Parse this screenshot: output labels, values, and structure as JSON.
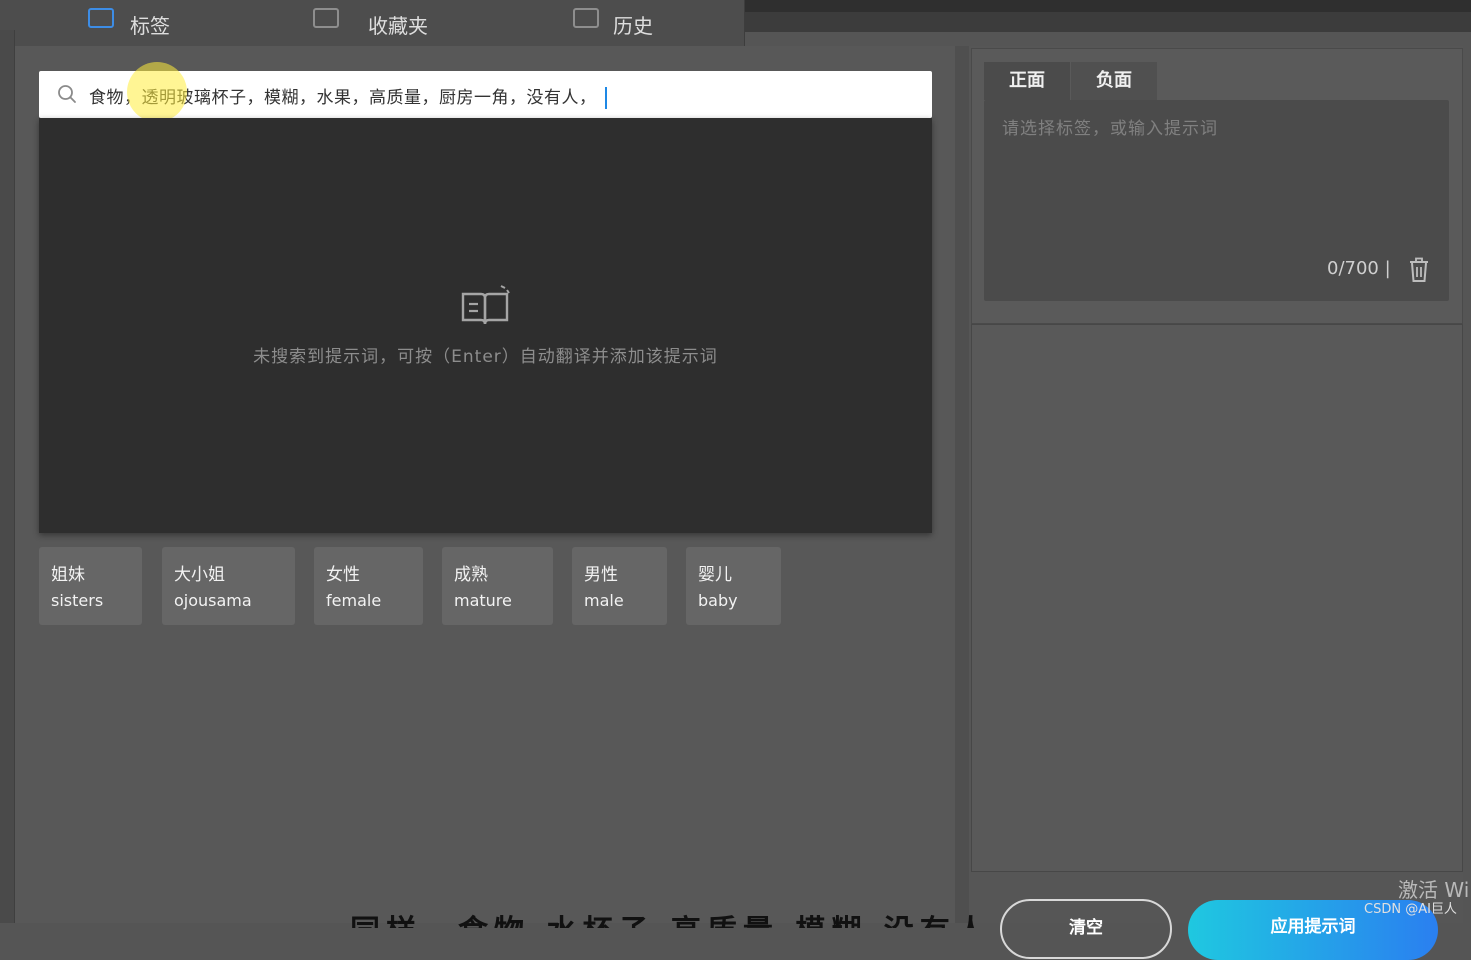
{
  "top_tabs": [
    {
      "label": "标签",
      "active": true
    },
    {
      "label": "收藏夹",
      "active": false
    },
    {
      "label": "历史",
      "active": false
    }
  ],
  "search": {
    "query": "食物，透明玻璃杯子，模糊，水果，高质量，厨房一角，没有人，",
    "icon": "search-icon"
  },
  "results": {
    "empty_icon": "open-book-icon",
    "empty_message": "未搜索到提示词，可按（Enter）自动翻译并添加该提示词"
  },
  "tags": [
    {
      "zh": "姐妹",
      "en": "sisters"
    },
    {
      "zh": "大小姐",
      "en": "ojousama"
    },
    {
      "zh": "女性",
      "en": "female"
    },
    {
      "zh": "成熟",
      "en": "mature"
    },
    {
      "zh": "男性",
      "en": "male"
    },
    {
      "zh": "婴儿",
      "en": "baby"
    }
  ],
  "prompt_panel": {
    "tabs": [
      "正面",
      "负面"
    ],
    "active_tab": "正面",
    "placeholder": "请选择标签，或输入提示词",
    "counter": "0/700",
    "clear_icon": "trash-icon"
  },
  "buttons": {
    "reset": "清空",
    "apply": "应用提示词"
  },
  "overlay": {
    "watermark": "激活 Wi",
    "credit": "CSDN @AI巨人",
    "subtitle_fragment": "同样，食物 水杯子 高质量 模糊 没有人"
  },
  "colors": {
    "accent": "#2a7ff0",
    "accent_start": "#1fc8e0",
    "caret": "#1e88e5",
    "active_tab_icon": "#3d8de6"
  }
}
